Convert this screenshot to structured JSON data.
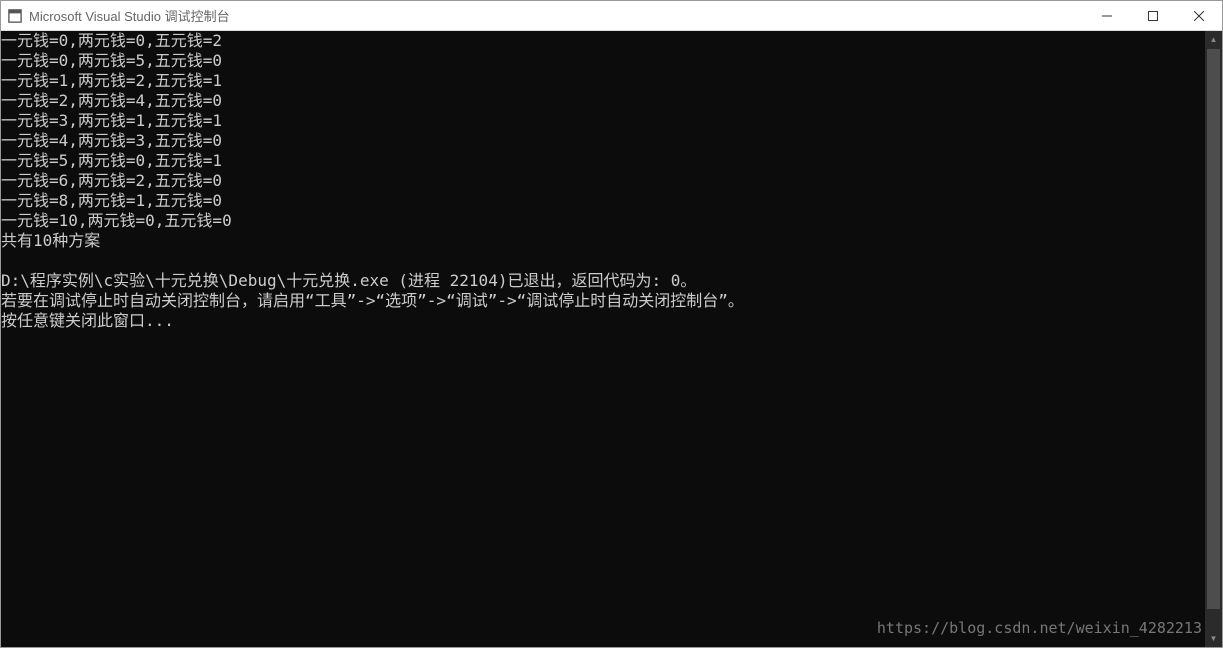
{
  "titlebar": {
    "title": "Microsoft Visual Studio 调试控制台"
  },
  "console": {
    "lines": [
      "一元钱=0,两元钱=0,五元钱=2",
      "一元钱=0,两元钱=5,五元钱=0",
      "一元钱=1,两元钱=2,五元钱=1",
      "一元钱=2,两元钱=4,五元钱=0",
      "一元钱=3,两元钱=1,五元钱=1",
      "一元钱=4,两元钱=3,五元钱=0",
      "一元钱=5,两元钱=0,五元钱=1",
      "一元钱=6,两元钱=2,五元钱=0",
      "一元钱=8,两元钱=1,五元钱=0",
      "一元钱=10,两元钱=0,五元钱=0",
      "共有10种方案",
      "",
      "D:\\程序实例\\c实验\\十元兑换\\Debug\\十元兑换.exe (进程 22104)已退出，返回代码为: 0。",
      "若要在调试停止时自动关闭控制台，请启用“工具”->“选项”->“调试”->“调试停止时自动关闭控制台”。",
      "按任意键关闭此窗口..."
    ]
  },
  "watermark": "https://blog.csdn.net/weixin_4282213"
}
